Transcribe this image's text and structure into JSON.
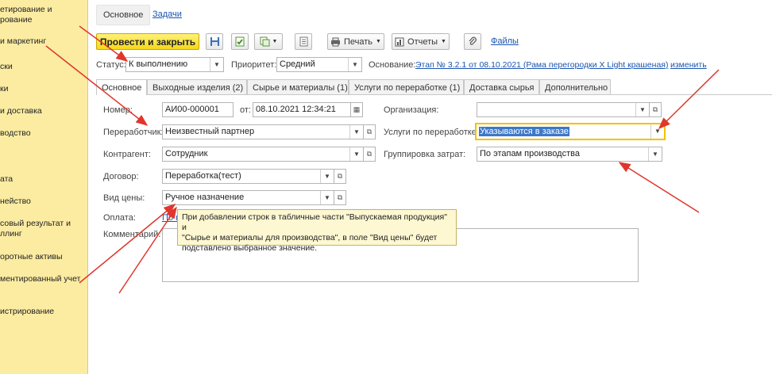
{
  "sidebar": {
    "items": [
      "етирование и",
      "рование",
      "и маркетинг",
      "ски",
      "ки",
      "и доставка",
      "водство",
      "ата",
      "нейство",
      "совый результат и",
      "ллинг",
      "оротные активы",
      "ментированный учет",
      "истрирование"
    ]
  },
  "top_tabs": {
    "main": "Основное",
    "tasks": "Задачи"
  },
  "toolbar": {
    "post_close": "Провести и закрыть",
    "print": "Печать",
    "reports": "Отчеты",
    "files": "Файлы"
  },
  "status_row": {
    "status_label": "Статус:",
    "status_value": "К выполнению",
    "priority_label": "Приоритет:",
    "priority_value": "Средний",
    "basis_label": "Основание:",
    "basis_link": "Этап № 3.2.1 от 08.10.2021 (Рама перегородки X Light крашеная)",
    "change_link": "изменить"
  },
  "form_tabs": [
    "Основное",
    "Выходные изделия (2)",
    "Сырье и материалы (1)",
    "Услуги по переработке (1)",
    "Доставка сырья",
    "Дополнительно"
  ],
  "fields": {
    "number_label": "Номер:",
    "number_value": "АИ00-000001",
    "from_label": "от:",
    "date_value": "08.10.2021 12:34:21",
    "org_label": "Организация:",
    "org_value": "",
    "processor_label": "Переработчик:",
    "processor_value": "Неизвестный партнер",
    "services_label": "Услуги по переработке:",
    "services_value": "Указываются в заказе",
    "counterparty_label": "Контрагент:",
    "counterparty_value": "Сотрудник",
    "cost_group_label": "Группировка затрат:",
    "cost_group_value": "По этапам производства",
    "contract_label": "Договор:",
    "contract_value": "Переработка(тест)",
    "price_type_label": "Вид цены:",
    "price_type_value": "Ручное назначение",
    "payment_label": "Оплата:",
    "payment_link": "По н",
    "comment_label": "Комментарий:"
  },
  "tooltip": {
    "line1": "При добавлении строк в табличные части \"Выпускаемая продукция\" и",
    "line2": "\"Сырье и материалы для производства\", в поле \"Вид цены\" будет",
    "line3": "подставлено выбранное значение."
  },
  "colors": {
    "sidebar_bg": "#fbeca2",
    "primary_button": "#f5d81a",
    "arrow": "#e0362c",
    "link": "#1a55b0",
    "highlight_border": "#f2c200"
  }
}
